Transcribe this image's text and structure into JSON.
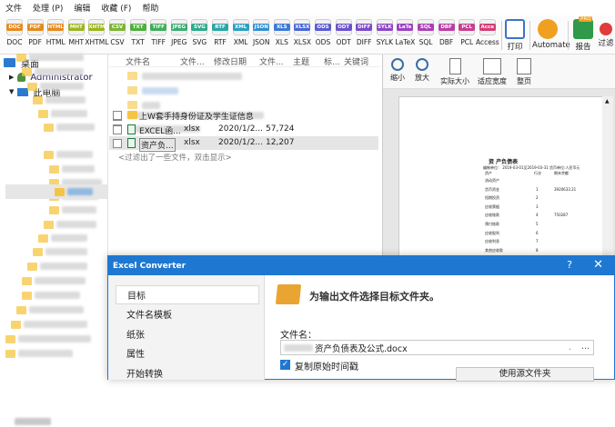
{
  "menu": [
    "文件",
    "处理 (P)",
    "编辑",
    "收藏 (F)",
    "帮助"
  ],
  "formats": [
    {
      "label": "DOC",
      "color": "#e58a1f"
    },
    {
      "label": "PDF",
      "color": "#e58a1f"
    },
    {
      "label": "HTML",
      "color": "#e58a1f"
    },
    {
      "label": "MHT",
      "color": "#9bb51e"
    },
    {
      "label": "XHTML",
      "color": "#9bb51e"
    },
    {
      "label": "CSV",
      "color": "#7ab532"
    },
    {
      "label": "TXT",
      "color": "#4fae3d"
    },
    {
      "label": "TIFF",
      "color": "#3cad5b"
    },
    {
      "label": "JPEG",
      "color": "#3aad72"
    },
    {
      "label": "SVG",
      "color": "#2eaa8c"
    },
    {
      "label": "RTF",
      "color": "#2aa6a8"
    },
    {
      "label": "XML",
      "color": "#2a9fc2"
    },
    {
      "label": "JSON",
      "color": "#2e8fd2"
    },
    {
      "label": "XLS",
      "color": "#3a7ad6"
    },
    {
      "label": "XLSX",
      "color": "#4766d6"
    },
    {
      "label": "ODS",
      "color": "#5a5bd3"
    },
    {
      "label": "ODT",
      "color": "#6a52cf"
    },
    {
      "label": "DIFF",
      "color": "#7b4bcb"
    },
    {
      "label": "SYLK",
      "color": "#8c45c6"
    },
    {
      "label": "LaTeX",
      "color": "#9b42c2"
    },
    {
      "label": "SQL",
      "color": "#ad3fb6"
    },
    {
      "label": "DBF",
      "color": "#bb3ea4"
    },
    {
      "label": "PCL",
      "color": "#c83d8f"
    },
    {
      "label": "Access",
      "color": "#d43c76"
    }
  ],
  "actions": {
    "print": "打印",
    "automate": "Automate",
    "report": "报告",
    "report_badge": "PRO",
    "favorite": "过滤"
  },
  "tree": {
    "desktop": "桌面",
    "admin": "Administrator",
    "pc": "此电脑"
  },
  "filelist": {
    "headers": [
      "文件名",
      "文件...",
      "修改日期",
      "文件...",
      "主题",
      "标...",
      "关键词"
    ],
    "folder_row": "上W套手持身份证及学生证信息",
    "files": [
      {
        "name": "EXCEL函...",
        "type": "xlsx",
        "date": "2020/1/2...",
        "size": "57,724"
      },
      {
        "name": "资产负...",
        "type": "xlsx",
        "date": "2020/1/2...",
        "size": "12,207"
      }
    ],
    "filter_note": "<过滤出了一些文件，双击显示>"
  },
  "preview": {
    "zoom_in": "缩小",
    "zoom_out": "放大",
    "actual": "实际大小",
    "fit_width": "适应宽度",
    "full_page": "整页"
  },
  "sheet": {
    "title": "资 产负债表",
    "meta": "编制单位：     2019-03-01至2019-03-31 货币单位:人民币元",
    "col1": "资产",
    "col2": "行次",
    "col3": "期末余额",
    "rows": [
      {
        "a": "流动资产",
        "b": "",
        "c": ""
      },
      {
        "a": "货币资金",
        "b": "1",
        "c": "3920633.21"
      },
      {
        "a": "短期投资",
        "b": "2",
        "c": ""
      },
      {
        "a": "应收票据",
        "b": "3",
        "c": ""
      },
      {
        "a": "应收账款",
        "b": "4",
        "c": "750287"
      },
      {
        "a": "预付账款",
        "b": "5",
        "c": ""
      },
      {
        "a": "应收股利",
        "b": "6",
        "c": ""
      },
      {
        "a": "应收利息",
        "b": "7",
        "c": ""
      },
      {
        "a": "其他应收款",
        "b": "8",
        "c": ""
      }
    ]
  },
  "dialog": {
    "title": "Excel Converter",
    "help": "?",
    "close": "✕",
    "nav": [
      "目标",
      "文件名模板",
      "纸张",
      "属性",
      "开始转换"
    ],
    "heading": "为输出文件选择目标文件夹。",
    "filename_label": "文件名：",
    "filename_value": "资产负债表及公式.docx",
    "copy_time_label": "复制原始时间戳",
    "use_source_button": "使用源文件夹",
    "browse": "..."
  }
}
